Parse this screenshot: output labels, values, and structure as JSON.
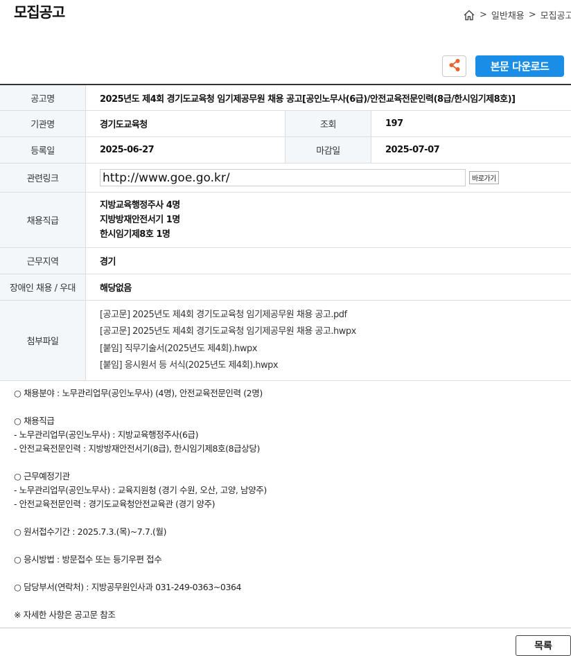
{
  "header": {
    "title": "모집공고",
    "breadcrumb": [
      ">",
      "일반채용",
      ">",
      "모집공고"
    ]
  },
  "actions": {
    "share_icon": "share-icon",
    "download_label": "본문 다운로드"
  },
  "info": {
    "title_label": "공고명",
    "title_value": "2025년도 제4회 경기도교육청 임기제공무원 채용 공고[공인노무사(6급)/안전교육전문인력(8급/한시임기제8호)]",
    "org_label": "기관명",
    "org_value": "경기도교육청",
    "views_label": "조회",
    "views_value": "197",
    "reg_label": "등록일",
    "reg_value": "2025-06-27",
    "deadline_label": "마감일",
    "deadline_value": "2025-07-07",
    "link_label": "관련링크",
    "link_value": "http://www.goe.go.kr/",
    "link_button": "바로가기",
    "positions_label": "채용직급",
    "positions": [
      "지방교육행정주사 4명",
      "지방방재안전서기 1명",
      "한시임기제8호 1명"
    ],
    "region_label": "근무지역",
    "region_value": "경기",
    "disabled_label": "장애인 채용 / 우대",
    "disabled_value": "해당없음",
    "files_label": "첨부파일",
    "files": [
      "[공고문] 2025년도 제4회 경기도교육청 임기제공무원 채용 공고.pdf",
      "[공고문] 2025년도 제4회 경기도교육청 임기제공무원 채용 공고.hwpx",
      "[붙임] 직무기술서(2025년도 제4회).hwpx",
      "[붙임] 응시원서 등 서식(2025년도 제4회).hwpx"
    ]
  },
  "body": {
    "lines": [
      "○ 채용분야 : 노무관리업무(공인노무사) (4명), 안전교육전문인력 (2명)",
      "",
      "○ 채용직급",
      " - 노무관리업무(공인노무사) : 지방교육행정주사(6급)",
      " - 안전교육전문인력 : 지방방재안전서기(8급), 한시임기제8호(8급상당)",
      "",
      "○ 근무예정기관",
      " - 노무관리업무(공인노무사) : 교육지원청 (경기 수원, 오산, 고양, 남양주)",
      " - 안전교육전문인력 : 경기도교육청안전교육관 (경기 양주)",
      "",
      "○ 원서접수기간 : 2025.7.3.(목)~7.7.(월)",
      "",
      "○ 응시방법 : 방문접수 또는 등기우편 접수",
      "",
      "○ 담당부서(연락처) : 지방공무원인사과 031-249-0363~0364",
      "",
      "※ 자세한 사항은 공고문 참조"
    ]
  },
  "footer": {
    "list_button": "목록"
  },
  "colors": {
    "accent": "#1a8ee6",
    "share": "#e8632a",
    "header_bg": "#f4f7fa"
  }
}
